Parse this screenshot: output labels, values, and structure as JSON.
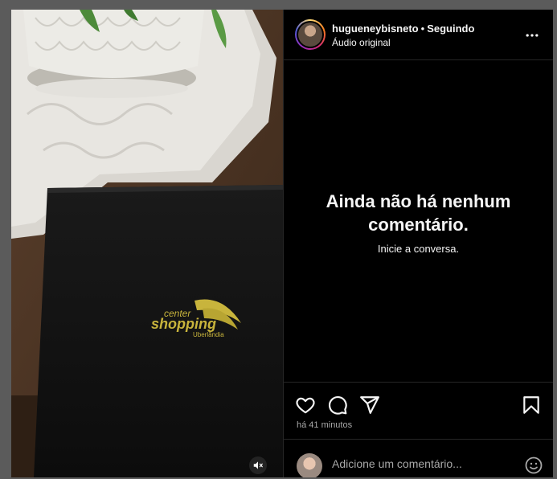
{
  "post": {
    "username": "hugueneybisneto",
    "separator": "•",
    "follow_status": "Seguindo",
    "audio": "Áudio original",
    "timestamp": "há 41 minutos"
  },
  "comments": {
    "empty_title": "Ainda não há nenhum comentário.",
    "empty_subtitle": "Inicie a conversa."
  },
  "comment_box": {
    "placeholder": "Adicione um comentário..."
  },
  "media": {
    "logo_line1": "center",
    "logo_line2": "shopping",
    "logo_line3": "Uberlândia",
    "muted": true
  },
  "icons": {
    "like": "heart-icon",
    "comment": "comment-icon",
    "share": "share-icon",
    "save": "bookmark-icon",
    "more": "more-icon",
    "mute": "speaker-muted-icon",
    "emoji": "emoji-icon"
  },
  "colors": {
    "background": "#000000",
    "text": "#f5f5f5",
    "muted_text": "#a8a8a8",
    "divider": "#262626",
    "logo_gold": "#c8b43c"
  }
}
